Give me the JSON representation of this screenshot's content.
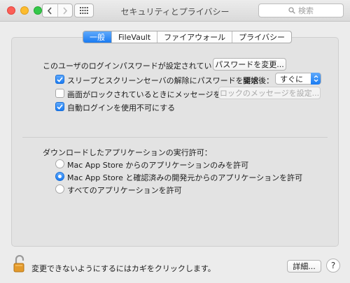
{
  "window": {
    "title": "セキュリティとプライバシー",
    "search_placeholder": "検索"
  },
  "tabs": [
    {
      "label": "一般",
      "active": true
    },
    {
      "label": "FileVault",
      "active": false
    },
    {
      "label": "ファイアウォール",
      "active": false
    },
    {
      "label": "プライバシー",
      "active": false
    }
  ],
  "general": {
    "password_label": "このユーザのログインパスワードが設定されています",
    "change_password_button": "パスワードを変更...",
    "require_password": {
      "label": "スリープとスクリーンセーバの解除にパスワードを要求",
      "checked": true
    },
    "after_label": "開始後：",
    "after_value": "すぐに",
    "show_message": {
      "label": "画面がロックされているときにメッセージを表示",
      "checked": false
    },
    "set_message_button": "ロックのメッセージを設定...",
    "disable_autologin": {
      "label": "自動ログインを使用不可にする",
      "checked": true
    },
    "download_heading": "ダウンロードしたアプリケーションの実行許可：",
    "download_options": [
      {
        "label": "Mac App Store からのアプリケーションのみを許可",
        "checked": false
      },
      {
        "label": "Mac App Store と確認済みの開発元からのアプリケーションを許可",
        "checked": true
      },
      {
        "label": "すべてのアプリケーションを許可",
        "checked": false
      }
    ]
  },
  "footer": {
    "lock_text": "変更できないようにするにはカギをクリックします。",
    "advanced_button": "詳細...",
    "help_label": "?"
  },
  "colors": {
    "accent": "#1a7bf2",
    "close": "#fc5f57",
    "minimize": "#fdbc2e",
    "maximize": "#34c84a"
  }
}
